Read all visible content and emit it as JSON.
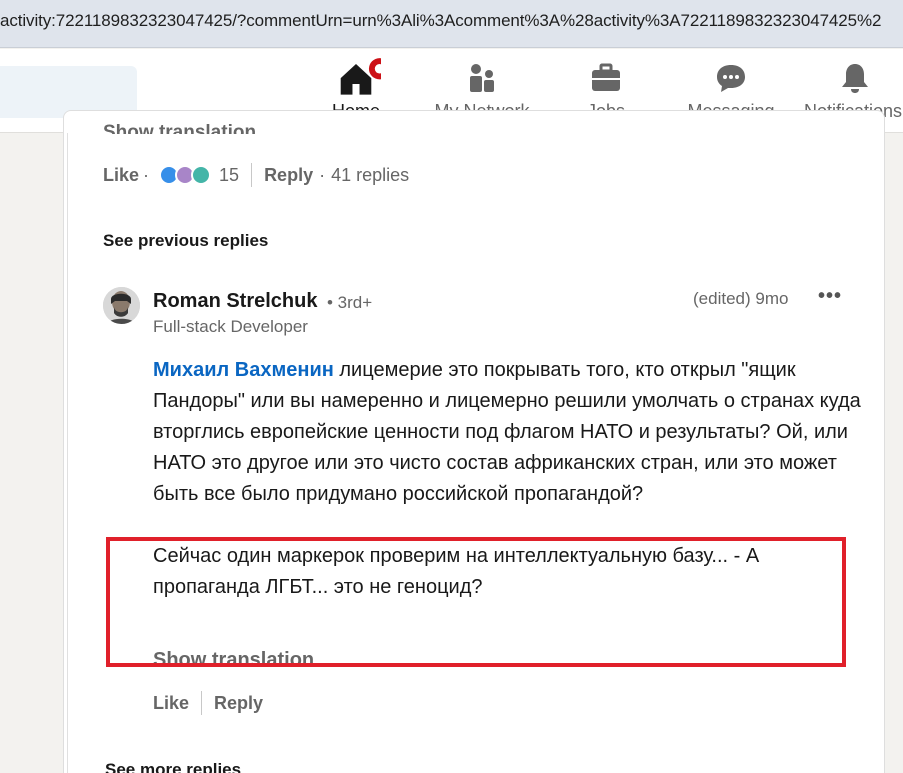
{
  "browser": {
    "url": "activity:7221189832323047425/?commentUrn=urn%3Ali%3Acomment%3A%28activity%3A7221189832323047425%2"
  },
  "nav": {
    "items": [
      {
        "label": "Home",
        "icon": "home-icon",
        "active": true
      },
      {
        "label": "My Network",
        "icon": "network-icon"
      },
      {
        "label": "Jobs",
        "icon": "briefcase-icon"
      },
      {
        "label": "Messaging",
        "icon": "messaging-icon"
      },
      {
        "label": "Notifications",
        "icon": "bell-icon"
      }
    ]
  },
  "parent_comment": {
    "show_translation": "Show translation",
    "like_label": "Like",
    "reaction_count": "15",
    "reply_label": "Reply",
    "replies_count": "41 replies"
  },
  "see_previous_replies": "See previous replies",
  "reply": {
    "author_name": "Roman Strelchuk",
    "degree": "• 3rd+",
    "headline": "Full-stack Developer",
    "edited_time": "(edited) 9mo",
    "more": "•••",
    "mention": "Михаил Вахменин",
    "text_part1": " лицемерие это покрывать того, кто открыл \"ящик Пандоры\" или вы намеренно и лицемерно решили умолчать о странах куда вторглись европейские ценности под флагом НАТО и результаты? Ой, или НАТО это другое или это чисто состав африканских стран, или это может быть все было придумано российской пропагандой?",
    "text_part2": "Сейчас один маркерок проверим на интеллектуальную базу... - А пропаганда ЛГБТ... это не геноцид?",
    "show_translation": "Show translation",
    "like_label": "Like",
    "reply_label": "Reply"
  },
  "see_more_replies": "See more replies",
  "colors": {
    "mention": "#0a66c2",
    "highlight_border": "#e0202a",
    "notification_badge": "#cc1016"
  }
}
